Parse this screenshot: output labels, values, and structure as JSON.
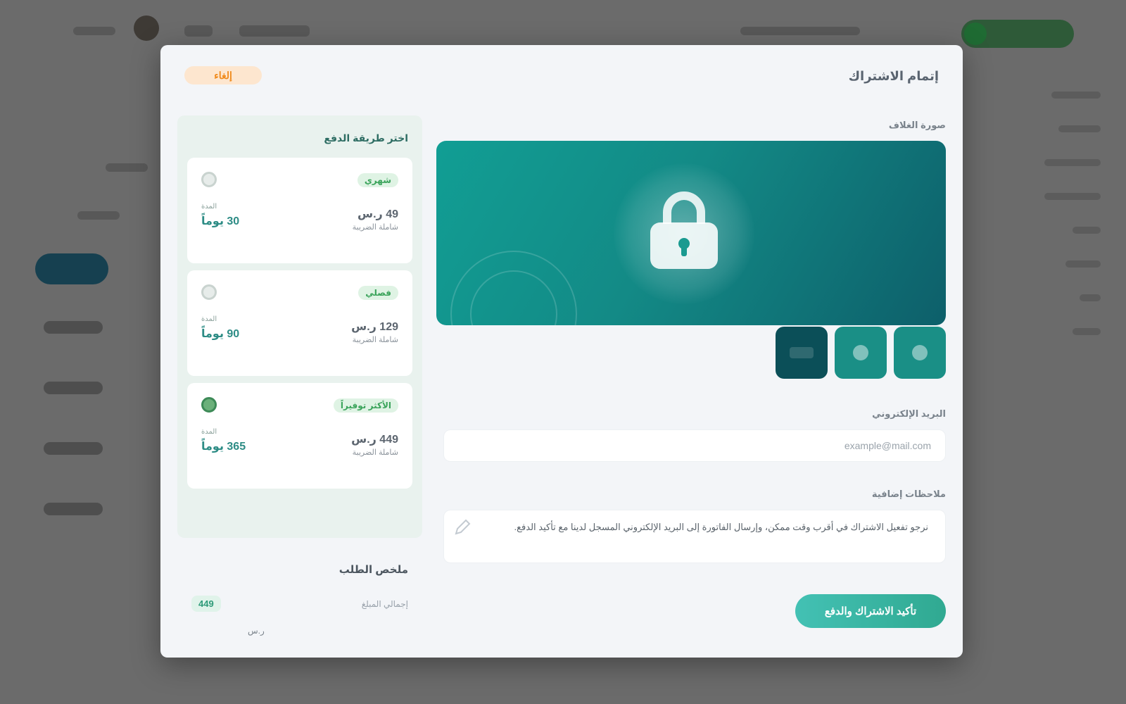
{
  "modal": {
    "close_label": "إلغاء",
    "title": "إتمام الاشتراك",
    "payment": {
      "heading": "اختر طريقة الدفع",
      "options": [
        {
          "badge": "شهري",
          "duration_caption": "المدة",
          "duration": "30 يوماً",
          "price": "49 ر.س",
          "price_note": "شاملة الضريبة",
          "selected": false
        },
        {
          "badge": "فصلي",
          "duration_caption": "المدة",
          "duration": "90 يوماً",
          "price": "129 ر.س",
          "price_note": "شاملة الضريبة",
          "selected": false
        },
        {
          "badge": "الأكثر توفيراً",
          "duration_caption": "المدة",
          "duration": "365 يوماً",
          "price": "449 ر.س",
          "price_note": "شاملة الضريبة",
          "selected": true
        }
      ]
    },
    "summary": {
      "title": "ملخص الطلب",
      "row_label": "إجمالي المبلغ",
      "row_value": "449",
      "foot": "ر.س"
    },
    "cover": {
      "label": "صورة الغلاف",
      "thumbnails": [
        "cover-teal",
        "cover-dark",
        "cover-light"
      ]
    },
    "email": {
      "label": "البريد الإلكتروني",
      "value": "",
      "placeholder": "example@mail.com"
    },
    "notes": {
      "label": "ملاحظات إضافية",
      "value": "نرجو تفعيل الاشتراك في أقرب وقت ممكن، وإرسال الفاتورة إلى البريد الإلكتروني المسجل لدينا مع تأكيد الدفع."
    },
    "submit_label": "تأكيد الاشتراك والدفع"
  },
  "colors": {
    "accent": "#138a86",
    "accent_dark": "#0d5f6a",
    "success": "#3aa35a",
    "warning": "#f08a1c"
  },
  "icons": {
    "banner": "lock-icon",
    "notes": "pen-icon"
  }
}
